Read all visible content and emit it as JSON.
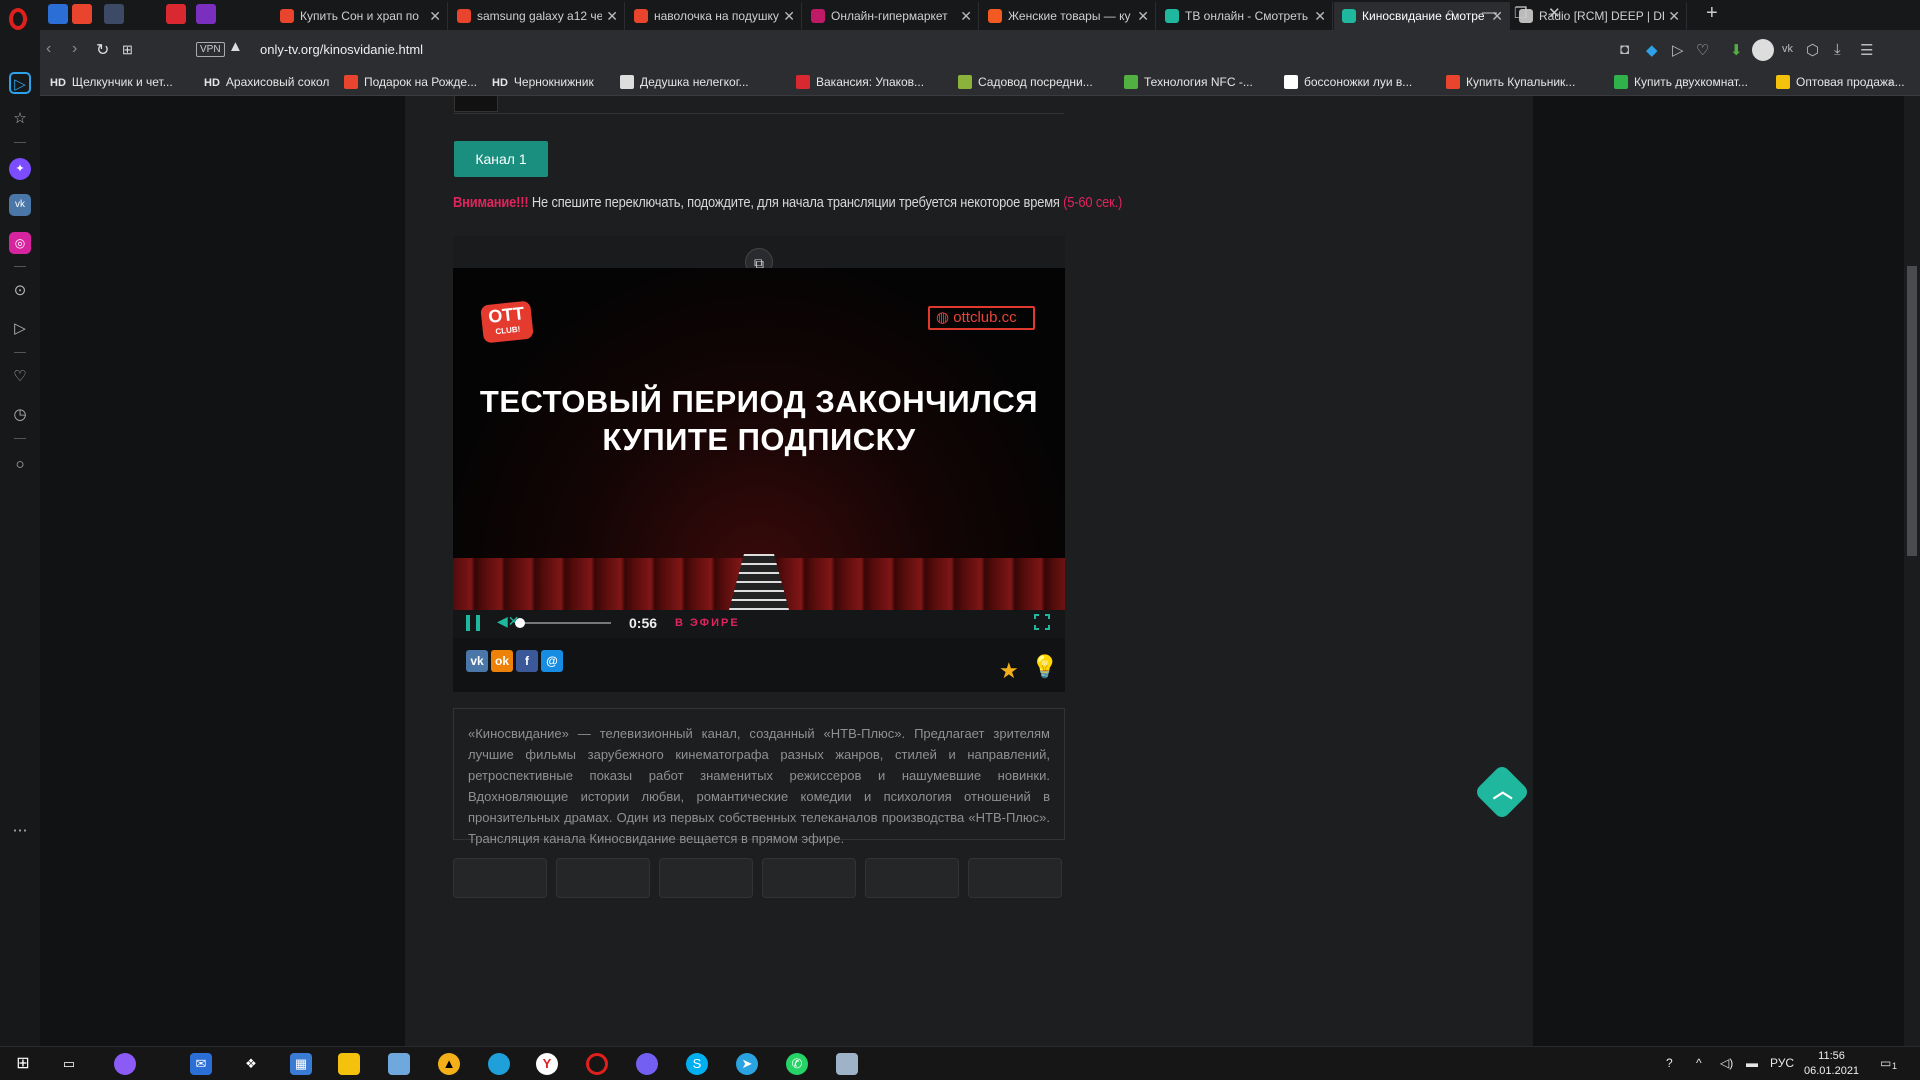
{
  "tabs": [
    {
      "label": "Купить Сон и храп по",
      "color": "#e8442e"
    },
    {
      "label": "samsung galaxy a12 че",
      "color": "#e8442e"
    },
    {
      "label": "наволочка на подушку",
      "color": "#e8442e"
    },
    {
      "label": "Онлайн-гипермаркет",
      "color": "#c01a66"
    },
    {
      "label": "Женские товары — ку",
      "color": "#f25a22"
    },
    {
      "label": "ТВ онлайн - Смотреть",
      "color": "#1fb89e"
    },
    {
      "label": "Киносвидание смотре",
      "color": "#1fb89e",
      "active": true
    },
    {
      "label": "Radio [RCM] DEEP | DE",
      "color": "#bbbbbb"
    }
  ],
  "address": {
    "vpn": "VPN",
    "url": "only-tv.org/kinosvidanie.html"
  },
  "bookmarks": [
    {
      "label": "Щелкунчик и чет...",
      "hd": "HD"
    },
    {
      "label": "Арахисовый сокол",
      "hd": "HD"
    },
    {
      "label": "Подарок на Рожде...",
      "color": "#e8442e"
    },
    {
      "label": "Чернокнижник",
      "hd": "HD"
    },
    {
      "label": "Дедушка нелегког...",
      "color": "#dddddd"
    },
    {
      "label": "Вакансия: Упаков...",
      "color": "#d9282f"
    },
    {
      "label": "Садовод посредни...",
      "color": "#8bb23a"
    },
    {
      "label": "Технология NFC -...",
      "color": "#52b043"
    },
    {
      "label": "боссоножки луи в...",
      "color": "#ffffff"
    },
    {
      "label": "Купить Купальник...",
      "color": "#e8442e"
    },
    {
      "label": "Купить двухкомнат...",
      "color": "#2fb24a"
    },
    {
      "label": "Оптовая продажа...",
      "color": "#f4c20d"
    }
  ],
  "page": {
    "channel_button": "Канал 1",
    "notice_warning": "Внимание!!!",
    "notice_text": " Не спешите переключать, подождите, для начала трансляции требуется некоторое время ",
    "notice_time": "(5-60 сек.)",
    "player": {
      "logo_text": "OTT",
      "logo_sub": "CLUB!",
      "site": "ottclub.cc",
      "message_line1": "ТЕСТОВЫЙ ПЕРИОД ЗАКОНЧИЛСЯ",
      "message_line2": "КУПИТЕ ПОДПИСКУ",
      "time": "0:56",
      "live_label": "В ЭФИРЕ",
      "volume_fraction": 0.0
    },
    "share": [
      {
        "name": "vk",
        "label": "vk",
        "color": "#4a76a8"
      },
      {
        "name": "ok",
        "label": "ok",
        "color": "#ee8208"
      },
      {
        "name": "facebook",
        "label": "f",
        "color": "#3b5998"
      },
      {
        "name": "moimir",
        "label": "@",
        "color": "#168de2"
      }
    ],
    "description": "«Киносвидание» — телевизионный канал, созданный «НТВ-Плюс». Предлагает зрителям лучшие фильмы зарубежного кинематографа разных жанров, стилей и направлений, ретроспективные показы работ знаменитых режиссеров и нашумевшие новинки. Вдохновляющие истории любви, романтические комедии и психология отношений в пронзительных драмах. Один из первых собственных телеканалов производства «НТВ-Плюс». Трансляция канала Киносвидание вещается в прямом эфире."
  },
  "taskbar": {
    "lang": "РУС",
    "time": "11:56",
    "date": "06.01.2021",
    "notif": "1"
  }
}
